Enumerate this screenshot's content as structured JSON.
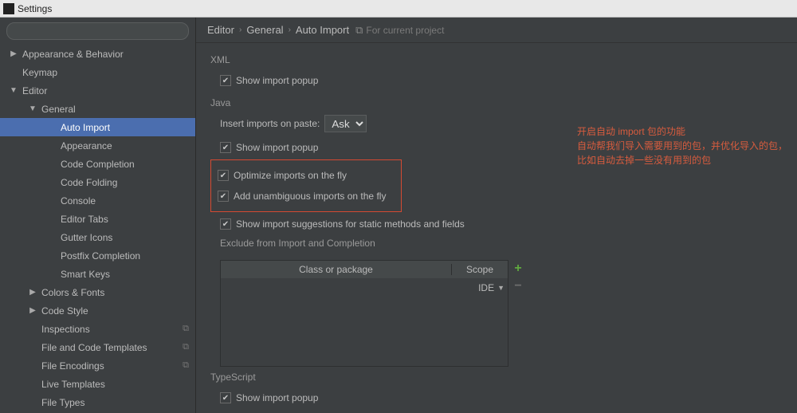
{
  "window": {
    "title": "Settings"
  },
  "search": {
    "placeholder": ""
  },
  "tree": [
    {
      "label": "Appearance & Behavior",
      "level": 0,
      "twisty": "right",
      "selected": false
    },
    {
      "label": "Keymap",
      "level": 0,
      "twisty": "none",
      "selected": false
    },
    {
      "label": "Editor",
      "level": 0,
      "twisty": "down",
      "selected": false
    },
    {
      "label": "General",
      "level": 1,
      "twisty": "down",
      "selected": false
    },
    {
      "label": "Auto Import",
      "level": 2,
      "twisty": "none",
      "selected": true
    },
    {
      "label": "Appearance",
      "level": 2,
      "twisty": "none",
      "selected": false
    },
    {
      "label": "Code Completion",
      "level": 2,
      "twisty": "none",
      "selected": false
    },
    {
      "label": "Code Folding",
      "level": 2,
      "twisty": "none",
      "selected": false
    },
    {
      "label": "Console",
      "level": 2,
      "twisty": "none",
      "selected": false
    },
    {
      "label": "Editor Tabs",
      "level": 2,
      "twisty": "none",
      "selected": false
    },
    {
      "label": "Gutter Icons",
      "level": 2,
      "twisty": "none",
      "selected": false
    },
    {
      "label": "Postfix Completion",
      "level": 2,
      "twisty": "none",
      "selected": false
    },
    {
      "label": "Smart Keys",
      "level": 2,
      "twisty": "none",
      "selected": false
    },
    {
      "label": "Colors & Fonts",
      "level": 1,
      "twisty": "right",
      "selected": false
    },
    {
      "label": "Code Style",
      "level": 1,
      "twisty": "right",
      "selected": false
    },
    {
      "label": "Inspections",
      "level": 1,
      "twisty": "none",
      "selected": false,
      "badge": "⧉"
    },
    {
      "label": "File and Code Templates",
      "level": 1,
      "twisty": "none",
      "selected": false,
      "badge": "⧉"
    },
    {
      "label": "File Encodings",
      "level": 1,
      "twisty": "none",
      "selected": false,
      "badge": "⧉"
    },
    {
      "label": "Live Templates",
      "level": 1,
      "twisty": "none",
      "selected": false
    },
    {
      "label": "File Types",
      "level": 1,
      "twisty": "none",
      "selected": false
    }
  ],
  "breadcrumb": {
    "parts": [
      "Editor",
      "General",
      "Auto Import"
    ],
    "project_hint": "For current project"
  },
  "xml": {
    "label": "XML",
    "show_popup": {
      "label": "Show import popup",
      "checked": true
    }
  },
  "java": {
    "label": "Java",
    "paste_label": "Insert imports on paste:",
    "paste_value": "Ask",
    "show_popup": {
      "label": "Show import popup",
      "checked": true
    },
    "optimize": {
      "label": "Optimize imports on the fly",
      "checked": true
    },
    "unambiguous": {
      "label": "Add unambiguous imports on the fly",
      "checked": true
    },
    "static": {
      "label": "Show import suggestions for static methods and fields",
      "checked": true
    },
    "exclude_label": "Exclude from Import and Completion",
    "exclude_cols": {
      "c1": "Class or package",
      "c2": "Scope"
    },
    "exclude_row_scope": "IDE"
  },
  "typescript": {
    "label": "TypeScript",
    "show_popup": {
      "label": "Show import popup",
      "checked": true
    }
  },
  "annotation": {
    "line1_a": "开启自动 ",
    "line1_b": "import",
    "line1_c": " 包的功能",
    "line2": "自动帮我们导入需要用到的包，并优化导入的包，比如自动去掉一些没有用到的包"
  }
}
